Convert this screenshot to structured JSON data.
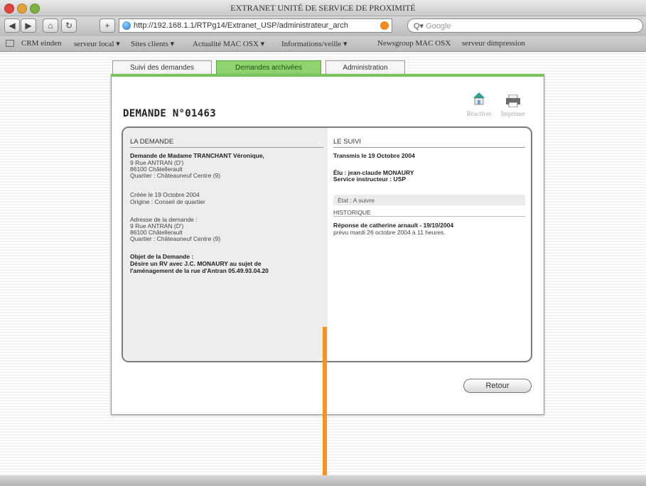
{
  "window": {
    "title": "EXTRANET UNITÉ DE SERVICE DE PROXIMITÉ"
  },
  "toolbar": {
    "back_icon": "◀",
    "forward_icon": "▶",
    "home_icon": "⌂",
    "reload_icon": "↻",
    "add_icon": "+",
    "url": "http://192.168.1.1/RTPg14/Extranet_USP/administrateur_arch",
    "search_placeholder": "Google",
    "search_icon": "Q▾"
  },
  "bookmarks": [
    "CRM einden",
    "serveur local ▾",
    "Sites clients ▾",
    "Actualité MAC OSX ▾",
    "Informations/veille ▾",
    "Newsgroup MAC OSX",
    "serveur dimpression"
  ],
  "tabs": [
    "Suivi des demandes",
    "Demandes archivées",
    "Administration"
  ],
  "active_tab": "Demandes archivées",
  "request": {
    "title": "DEMANDE N°01463",
    "actions": {
      "reactivate": "Réactiver",
      "print": "Imprimer"
    }
  },
  "left": {
    "header": "LA DEMANDE",
    "requester": "Demande de Madame TRANCHANT Véronique,",
    "address": [
      "9 Rue ANTRAN (D')",
      "86100 Châtellerault",
      "Quartier : Châteauneuf Centre (9)"
    ],
    "created": "Créée le 19 Octobre 2004",
    "origin": "Origine : Conseil de quartier",
    "request_address_label": "Adresse de la demande :",
    "request_address": [
      "9 Rue ANTRAN (D')",
      "86100 Châtellerault",
      "Quartier : Châteauneuf Centre (9)"
    ],
    "object_label": "Objet de la Demande :",
    "object_lines": [
      "Désire un RV avec J.C. MONAURY au sujet de",
      "l'aménagement de la rue d'Antran 05.49.93.04.20"
    ]
  },
  "right": {
    "header": "LE SUIVI",
    "transmitted": "Transmis le 19 Octobre 2004",
    "elu": "Élu : jean-claude MONAURY",
    "service": "Service instructeur : USP",
    "state": "État : A suivre",
    "history_label": "HISTORIQUE",
    "history_title": "Réponse de catherine arnault - 19/10/2004",
    "history_text": "prévu mardi 26 octobre 2004 à 11 heures."
  },
  "retour_label": "Retour",
  "colors": {
    "accent": "#7ac35a",
    "overlay_line": "#f7941d"
  }
}
